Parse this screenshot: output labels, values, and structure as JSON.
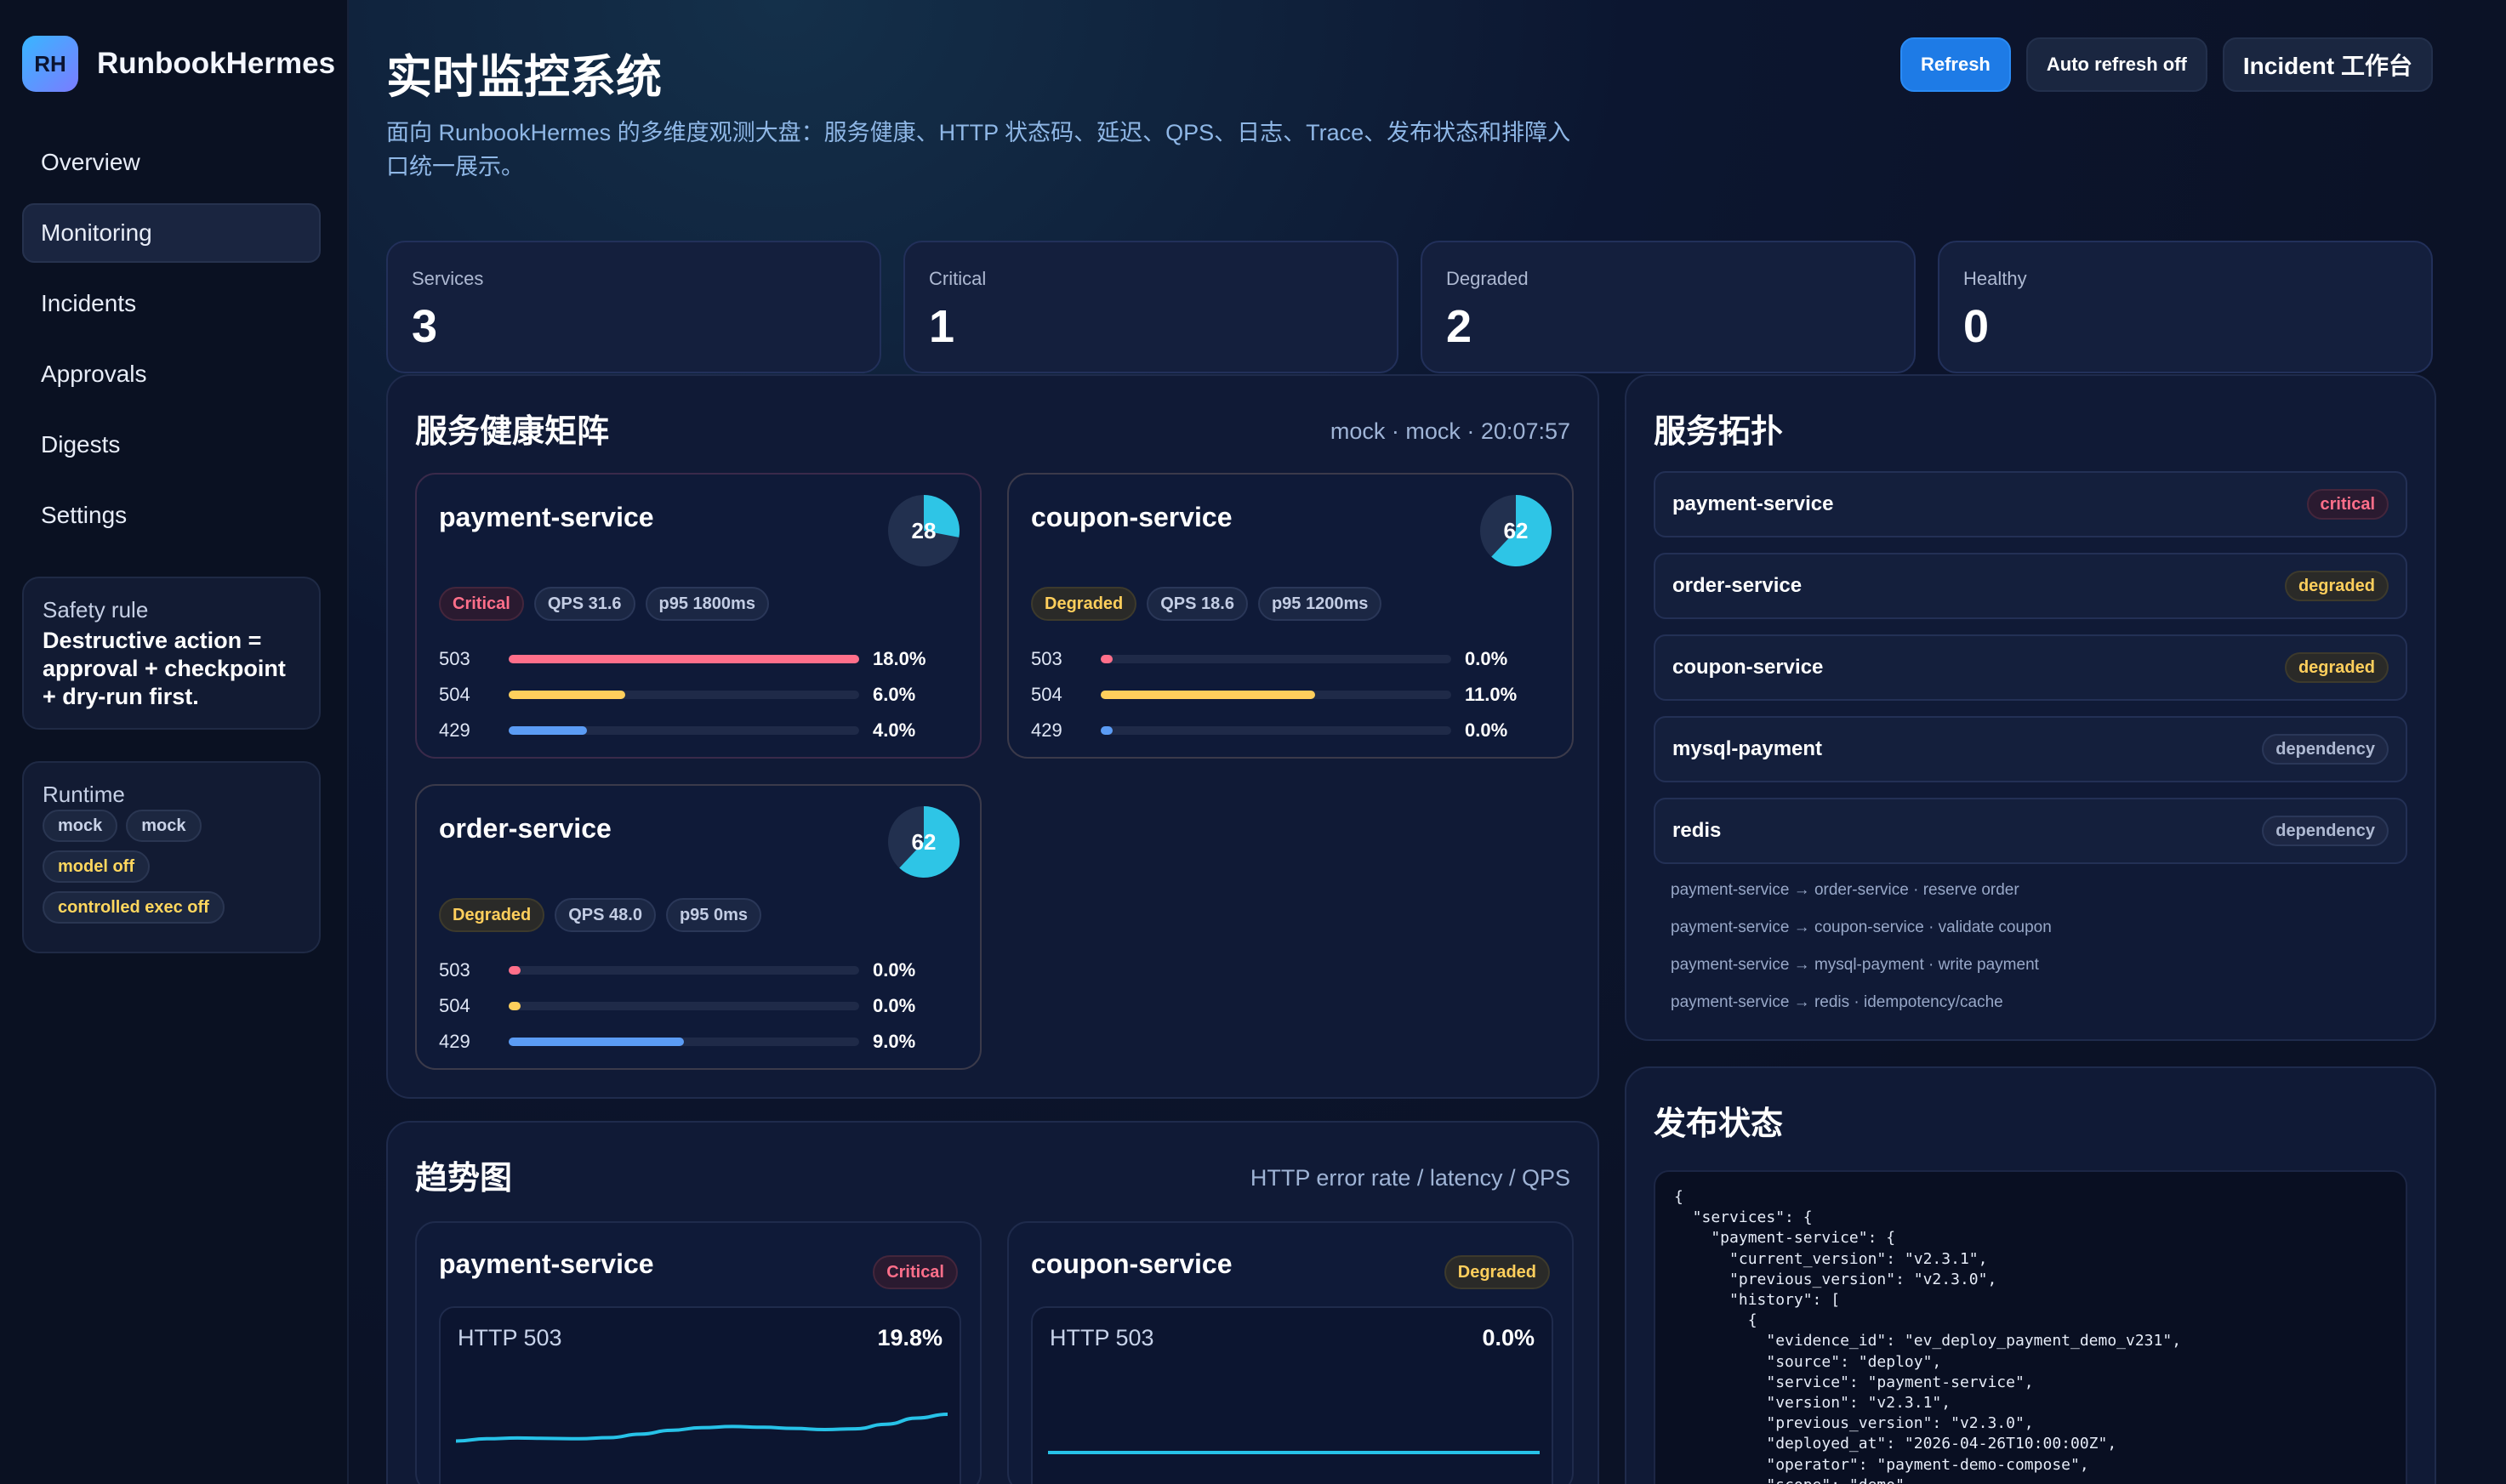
{
  "brand": {
    "logo": "RH",
    "name": "RunbookHermes"
  },
  "nav": [
    {
      "label": "Overview",
      "active": false
    },
    {
      "label": "Monitoring",
      "active": true
    },
    {
      "label": "Incidents",
      "active": false
    },
    {
      "label": "Approvals",
      "active": false
    },
    {
      "label": "Digests",
      "active": false
    },
    {
      "label": "Settings",
      "active": false
    }
  ],
  "safety": {
    "title": "Safety rule",
    "text": "Destructive action = approval + checkpoint + dry-run first."
  },
  "runtime": {
    "title": "Runtime",
    "pills": [
      "mock",
      "mock",
      "model off",
      "controlled exec off"
    ]
  },
  "header": {
    "title": "实时监控系统",
    "subtitle": "面向 RunbookHermes 的多维度观测大盘：服务健康、HTTP 状态码、延迟、QPS、日志、Trace、发布状态和排障入口统一展示。",
    "buttons": {
      "refresh": "Refresh",
      "auto_refresh": "Auto refresh off",
      "incident": "Incident 工作台"
    }
  },
  "stats": [
    {
      "label": "Services",
      "value": "3"
    },
    {
      "label": "Critical",
      "value": "1"
    },
    {
      "label": "Degraded",
      "value": "2"
    },
    {
      "label": "Healthy",
      "value": "0"
    }
  ],
  "health": {
    "title": "服务健康矩阵",
    "meta": "mock · mock · 20:07:57",
    "services": [
      {
        "name": "payment-service",
        "score": "28",
        "score_value": 28,
        "status": "Critical",
        "qps": "QPS 31.6",
        "p95": "p95 1800ms",
        "codes": [
          {
            "code": "503",
            "pct": "18.0%",
            "value": 18.0,
            "color": "#ff6f8a"
          },
          {
            "code": "504",
            "pct": "6.0%",
            "value": 6.0,
            "color": "#ffcf5c"
          },
          {
            "code": "429",
            "pct": "4.0%",
            "value": 4.0,
            "color": "#5b9cf5"
          }
        ]
      },
      {
        "name": "coupon-service",
        "score": "62",
        "score_value": 62,
        "status": "Degraded",
        "qps": "QPS 18.6",
        "p95": "p95 1200ms",
        "codes": [
          {
            "code": "503",
            "pct": "0.0%",
            "value": 0.0,
            "color": "#ff6f8a"
          },
          {
            "code": "504",
            "pct": "11.0%",
            "value": 11.0,
            "color": "#ffcf5c"
          },
          {
            "code": "429",
            "pct": "0.0%",
            "value": 0.0,
            "color": "#5b9cf5"
          }
        ]
      },
      {
        "name": "order-service",
        "score": "62",
        "score_value": 62,
        "status": "Degraded",
        "qps": "QPS 48.0",
        "p95": "p95 0ms",
        "codes": [
          {
            "code": "503",
            "pct": "0.0%",
            "value": 0.0,
            "color": "#ff6f8a"
          },
          {
            "code": "504",
            "pct": "0.0%",
            "value": 0.0,
            "color": "#ffcf5c"
          },
          {
            "code": "429",
            "pct": "9.0%",
            "value": 9.0,
            "color": "#5b9cf5"
          }
        ]
      }
    ]
  },
  "topology": {
    "title": "服务拓扑",
    "nodes": [
      {
        "name": "payment-service",
        "status": "critical"
      },
      {
        "name": "order-service",
        "status": "degraded"
      },
      {
        "name": "coupon-service",
        "status": "degraded"
      },
      {
        "name": "mysql-payment",
        "status": "dependency"
      },
      {
        "name": "redis",
        "status": "dependency"
      }
    ],
    "edges": [
      "payment-service → order-service · reserve order",
      "payment-service → coupon-service · validate coupon",
      "payment-service → mysql-payment · write payment",
      "payment-service → redis · idempotency/cache"
    ]
  },
  "trends": {
    "title": "趋势图",
    "meta": "HTTP error rate / latency / QPS",
    "cards": [
      {
        "name": "payment-service",
        "status": "Critical",
        "metric": "HTTP 503",
        "value": "19.8%",
        "series": [
          3.0,
          3.6,
          3.8,
          3.7,
          3.6,
          3.9,
          4.8,
          5.8,
          6.5,
          6.8,
          6.6,
          6.3,
          6.0,
          6.2,
          7.4,
          9.0,
          10.0
        ]
      },
      {
        "name": "coupon-service",
        "status": "Degraded",
        "metric": "HTTP 503",
        "value": "0.0%",
        "series": [
          0,
          0,
          0,
          0,
          0,
          0,
          0,
          0,
          0,
          0,
          0,
          0,
          0,
          0,
          0,
          0,
          0
        ]
      }
    ]
  },
  "release": {
    "title": "发布状态",
    "code": "{\n  \"services\": {\n    \"payment-service\": {\n      \"current_version\": \"v2.3.1\",\n      \"previous_version\": \"v2.3.0\",\n      \"history\": [\n        {\n          \"evidence_id\": \"ev_deploy_payment_demo_v231\",\n          \"source\": \"deploy\",\n          \"service\": \"payment-service\",\n          \"version\": \"v2.3.1\",\n          \"previous_version\": \"v2.3.0\",\n          \"deployed_at\": \"2026-04-26T10:00:00Z\",\n          \"operator\": \"payment-demo-compose\",\n          \"scope\": \"demo\","
  },
  "colors": {
    "accent": "#1e7be6",
    "critical": "#ff6f8a",
    "degraded": "#ffcf5c",
    "gauge": "#2ec5e6",
    "trend": "#27c2e8"
  }
}
